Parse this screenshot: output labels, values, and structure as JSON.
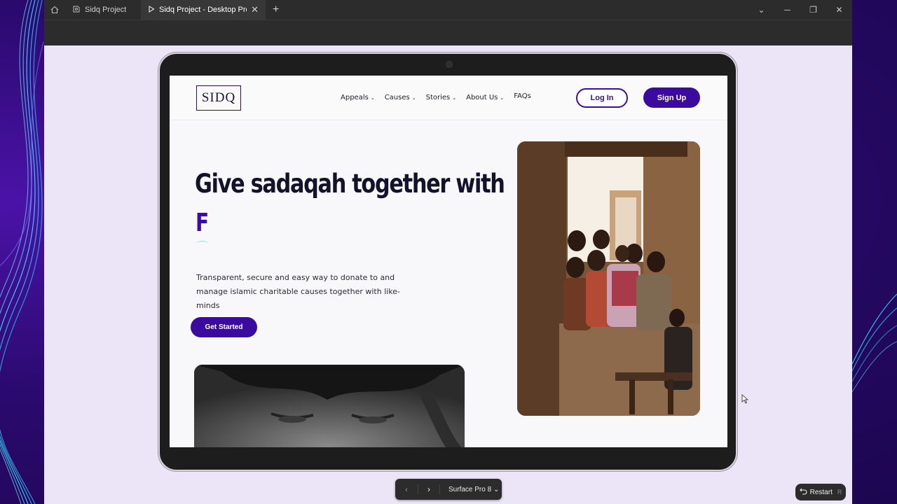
{
  "browser": {
    "tabs": [
      {
        "title": "Sidq Project"
      },
      {
        "title": "Sidq Project - Desktop Prototype"
      }
    ]
  },
  "site": {
    "logo_text": "SIDQ",
    "nav": [
      {
        "label": "Appeals"
      },
      {
        "label": "Causes"
      },
      {
        "label": "Stories"
      },
      {
        "label": "About Us"
      },
      {
        "label": "FAQs"
      }
    ],
    "login_label": "Log In",
    "signup_label": "Sign Up"
  },
  "hero": {
    "title": "Give sadaqah together with",
    "typed_text": "F",
    "description": "Transparent, secure and easy way to donate to and manage islamic charitable causes together with like-minds",
    "cta_label": "Get Started"
  },
  "prototype_controls": {
    "device_name": "Surface Pro 8",
    "restart_label": "Restart",
    "restart_shortcut": "R"
  },
  "colors": {
    "brand_purple": "#3b0a9e",
    "canvas_bg": "#ece5f8",
    "figma_chrome": "#2c2c2c"
  }
}
